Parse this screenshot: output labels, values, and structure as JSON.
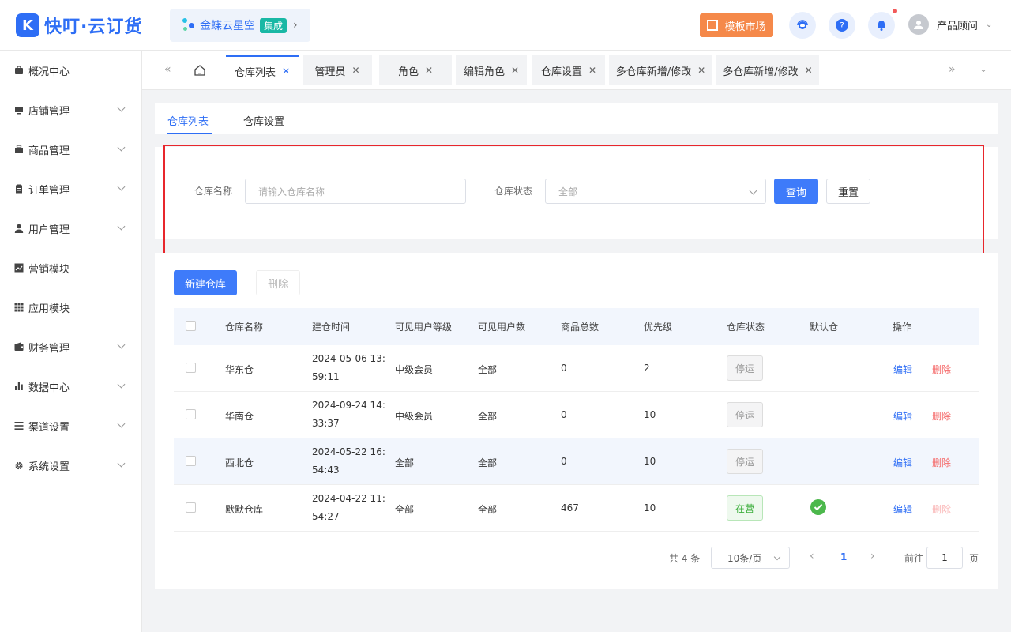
{
  "brand": {
    "name": "快叮·云订货",
    "mark": "K"
  },
  "kingdee": {
    "name": "金蝶云星空",
    "badge": "集成",
    "arrow": "›"
  },
  "header": {
    "market_label": "模板市场",
    "user_name": "产品顾问"
  },
  "sidebar": {
    "items": [
      {
        "label": "概况中心",
        "icon": "briefcase-icon",
        "expandable": false
      },
      {
        "label": "店铺管理",
        "icon": "store-icon",
        "expandable": true
      },
      {
        "label": "商品管理",
        "icon": "box-icon",
        "expandable": true
      },
      {
        "label": "订单管理",
        "icon": "clipboard-icon",
        "expandable": true
      },
      {
        "label": "用户管理",
        "icon": "user-icon",
        "expandable": true
      },
      {
        "label": "营销模块",
        "icon": "trend-icon",
        "expandable": false
      },
      {
        "label": "应用模块",
        "icon": "grid-icon",
        "expandable": false
      },
      {
        "label": "财务管理",
        "icon": "wallet-icon",
        "expandable": true
      },
      {
        "label": "数据中心",
        "icon": "bar-chart-icon",
        "expandable": true
      },
      {
        "label": "渠道设置",
        "icon": "list-icon",
        "expandable": true
      },
      {
        "label": "系统设置",
        "icon": "gear-icon",
        "expandable": true
      }
    ]
  },
  "page_tabs": [
    {
      "label": "仓库列表",
      "active": true
    },
    {
      "label": "管理员",
      "active": false
    },
    {
      "label": "角色",
      "active": false
    },
    {
      "label": "编辑角色",
      "active": false
    },
    {
      "label": "仓库设置",
      "active": false
    },
    {
      "label": "多仓库新增/修改",
      "active": false
    },
    {
      "label": "多仓库新增/修改",
      "active": false
    }
  ],
  "sub_tabs": [
    "仓库列表",
    "仓库设置"
  ],
  "filter": {
    "name_label": "仓库名称",
    "name_placeholder": "请输入仓库名称",
    "status_label": "仓库状态",
    "status_value": "全部",
    "query_label": "查询",
    "reset_label": "重置"
  },
  "toolbar": {
    "new_label": "新建仓库",
    "delete_label": "删除"
  },
  "table": {
    "headers": [
      "仓库名称",
      "建仓时间",
      "可见用户等级",
      "可见用户数",
      "商品总数",
      "优先级",
      "仓库状态",
      "默认仓",
      "操作"
    ],
    "rows": [
      {
        "name": "华东仓",
        "created_1": "2024-05-06 13:",
        "created_2": "59:11",
        "level": "中级会员",
        "users": "全部",
        "goods": "0",
        "priority": "2",
        "status": "停运",
        "default": false,
        "edit": "编辑",
        "del": "删除"
      },
      {
        "name": "华南仓",
        "created_1": "2024-09-24 14:",
        "created_2": "33:37",
        "level": "中级会员",
        "users": "全部",
        "goods": "0",
        "priority": "10",
        "status": "停运",
        "default": false,
        "edit": "编辑",
        "del": "删除"
      },
      {
        "name": "西北仓",
        "created_1": "2024-05-22 16:",
        "created_2": "54:43",
        "level": "全部",
        "users": "全部",
        "goods": "0",
        "priority": "10",
        "status": "停运",
        "default": false,
        "edit": "编辑",
        "del": "删除"
      },
      {
        "name": "默默仓库",
        "created_1": "2024-04-22 11:",
        "created_2": "54:27",
        "level": "全部",
        "users": "全部",
        "goods": "467",
        "priority": "10",
        "status": "在营",
        "default": true,
        "edit": "编辑",
        "del": "删除"
      }
    ]
  },
  "pagination": {
    "total": "共 4 条",
    "page_size": "10条/页",
    "current": "1",
    "goto_label": "前往",
    "goto_value": "1",
    "page_suffix": "页"
  },
  "colors": {
    "accent": "#2e6ef5",
    "danger": "#f56c6c",
    "highlight_box": "#e8262c",
    "market": "#f5894a"
  }
}
